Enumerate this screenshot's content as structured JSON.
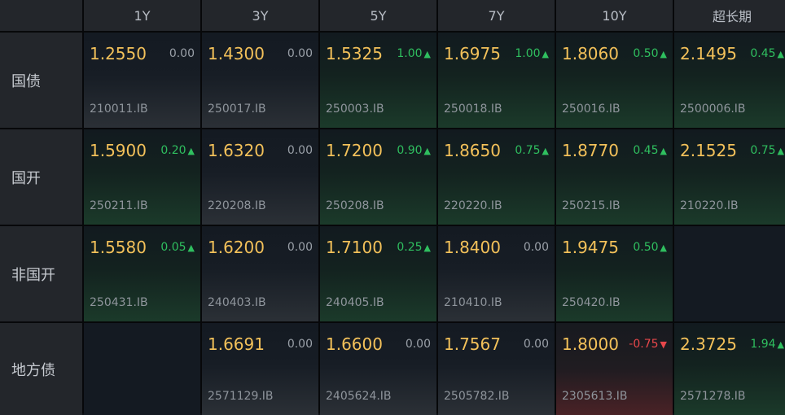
{
  "columns": [
    "1Y",
    "3Y",
    "5Y",
    "7Y",
    "10Y",
    "超长期"
  ],
  "rows": [
    {
      "label": "国债",
      "cells": [
        {
          "yield": "1.2550",
          "change": "0.00",
          "dir": "flat",
          "code": "210011.IB"
        },
        {
          "yield": "1.4300",
          "change": "0.00",
          "dir": "flat",
          "code": "250017.IB"
        },
        {
          "yield": "1.5325",
          "change": "1.00",
          "dir": "up",
          "code": "250003.IB"
        },
        {
          "yield": "1.6975",
          "change": "1.00",
          "dir": "up",
          "code": "250018.IB"
        },
        {
          "yield": "1.8060",
          "change": "0.50",
          "dir": "up",
          "code": "250016.IB"
        },
        {
          "yield": "2.1495",
          "change": "0.45",
          "dir": "up",
          "code": "2500006.IB"
        }
      ]
    },
    {
      "label": "国开",
      "cells": [
        {
          "yield": "1.5900",
          "change": "0.20",
          "dir": "up",
          "code": "250211.IB"
        },
        {
          "yield": "1.6320",
          "change": "0.00",
          "dir": "flat",
          "code": "220208.IB"
        },
        {
          "yield": "1.7200",
          "change": "0.90",
          "dir": "up",
          "code": "250208.IB"
        },
        {
          "yield": "1.8650",
          "change": "0.75",
          "dir": "up",
          "code": "220220.IB"
        },
        {
          "yield": "1.8770",
          "change": "0.45",
          "dir": "up",
          "code": "250215.IB"
        },
        {
          "yield": "2.1525",
          "change": "0.75",
          "dir": "up",
          "code": "210220.IB"
        }
      ]
    },
    {
      "label": "非国开",
      "cells": [
        {
          "yield": "1.5580",
          "change": "0.05",
          "dir": "up",
          "code": "250431.IB"
        },
        {
          "yield": "1.6200",
          "change": "0.00",
          "dir": "flat",
          "code": "240403.IB"
        },
        {
          "yield": "1.7100",
          "change": "0.25",
          "dir": "up",
          "code": "240405.IB"
        },
        {
          "yield": "1.8400",
          "change": "0.00",
          "dir": "flat",
          "code": "210410.IB"
        },
        {
          "yield": "1.9475",
          "change": "0.50",
          "dir": "up",
          "code": "250420.IB"
        },
        null
      ]
    },
    {
      "label": "地方债",
      "cells": [
        null,
        {
          "yield": "1.6691",
          "change": "0.00",
          "dir": "flat",
          "code": "2571129.IB"
        },
        {
          "yield": "1.6600",
          "change": "0.00",
          "dir": "flat",
          "code": "2405624.IB"
        },
        {
          "yield": "1.7567",
          "change": "0.00",
          "dir": "flat",
          "code": "2505782.IB"
        },
        {
          "yield": "1.8000",
          "change": "-0.75",
          "dir": "down",
          "code": "2305613.IB"
        },
        {
          "yield": "2.3725",
          "change": "1.94",
          "dir": "up",
          "code": "2571278.IB"
        }
      ]
    }
  ],
  "colors": {
    "yield": "#f3c15a",
    "up": "#2fbf5f",
    "down": "#e8474b",
    "flat": "#9aa0a8"
  },
  "icons": {
    "up": "▲",
    "down": "▼"
  }
}
